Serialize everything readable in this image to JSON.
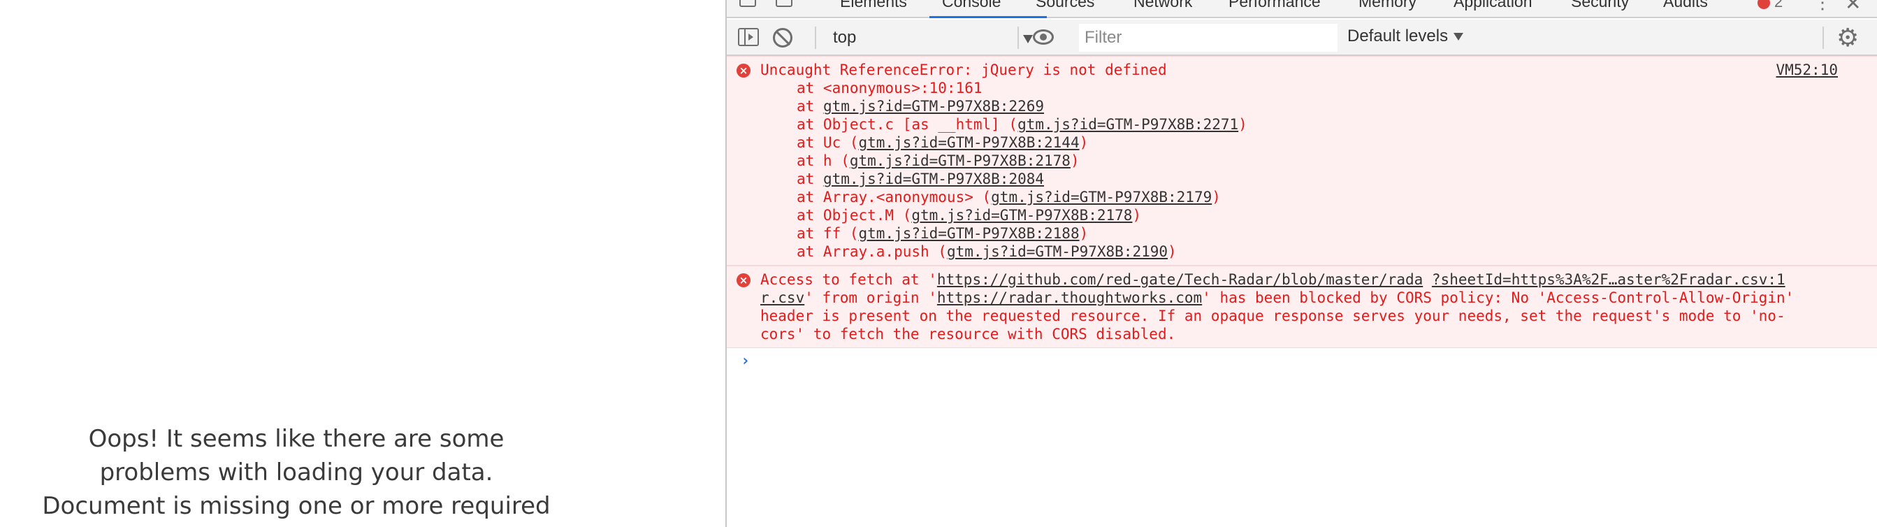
{
  "page": {
    "message_lines": [
      "Oops! It seems like there are some",
      "problems with loading your data.",
      "Document is missing one or more required"
    ]
  },
  "devtools": {
    "tabs": [
      "Elements",
      "Console",
      "Sources",
      "Network",
      "Performance",
      "Memory",
      "Application",
      "Security",
      "Audits"
    ],
    "active_tab": "Console",
    "error_count": "2",
    "toolbar": {
      "context": "top",
      "filter_placeholder": "Filter",
      "levels": "Default levels"
    },
    "messages": {
      "m1": {
        "text": "Uncaught ReferenceError: jQuery is not defined",
        "source": "VM52:10",
        "s1": "at <anonymous>:10:161",
        "s2_pre": "at ",
        "s2_link": "gtm.js?id=GTM-P97X8B:2269",
        "s3_pre": "at Object.c [as __html] (",
        "s3_link": "gtm.js?id=GTM-P97X8B:2271",
        "s3_post": ")",
        "s4_pre": "at Uc (",
        "s4_link": "gtm.js?id=GTM-P97X8B:2144",
        "s4_post": ")",
        "s5_pre": "at h (",
        "s5_link": "gtm.js?id=GTM-P97X8B:2178",
        "s5_post": ")",
        "s6_pre": "at ",
        "s6_link": "gtm.js?id=GTM-P97X8B:2084",
        "s7_pre": "at Array.<anonymous> (",
        "s7_link": "gtm.js?id=GTM-P97X8B:2179",
        "s7_post": ")",
        "s8_pre": "at Object.M (",
        "s8_link": "gtm.js?id=GTM-P97X8B:2178",
        "s8_post": ")",
        "s9_pre": "at ff (",
        "s9_link": "gtm.js?id=GTM-P97X8B:2188",
        "s9_post": ")",
        "s10_pre": "at Array.a.push (",
        "s10_link": "gtm.js?id=GTM-P97X8B:2190",
        "s10_post": ")"
      },
      "m2": {
        "l1_pre": "Access to fetch at '",
        "l1_link1": "https://github.com/red-gate/Tech-Radar/blob/master/rada",
        "l1_gap": " ",
        "l1_link2": "?sheetId=https%3A%2F…aster%2Fradar.csv:1",
        "l2_link": "r.csv",
        "l2_mid": "' from origin '",
        "l2_link2": "https://radar.thoughtworks.com",
        "l2_post": "' has been blocked by CORS policy: No 'Access-Control-Allow-Origin'",
        "l3": "header is present on the requested resource. If an opaque response serves your needs, set the request's mode to 'no-",
        "l4": "cors' to fetch the resource with CORS disabled."
      }
    }
  }
}
